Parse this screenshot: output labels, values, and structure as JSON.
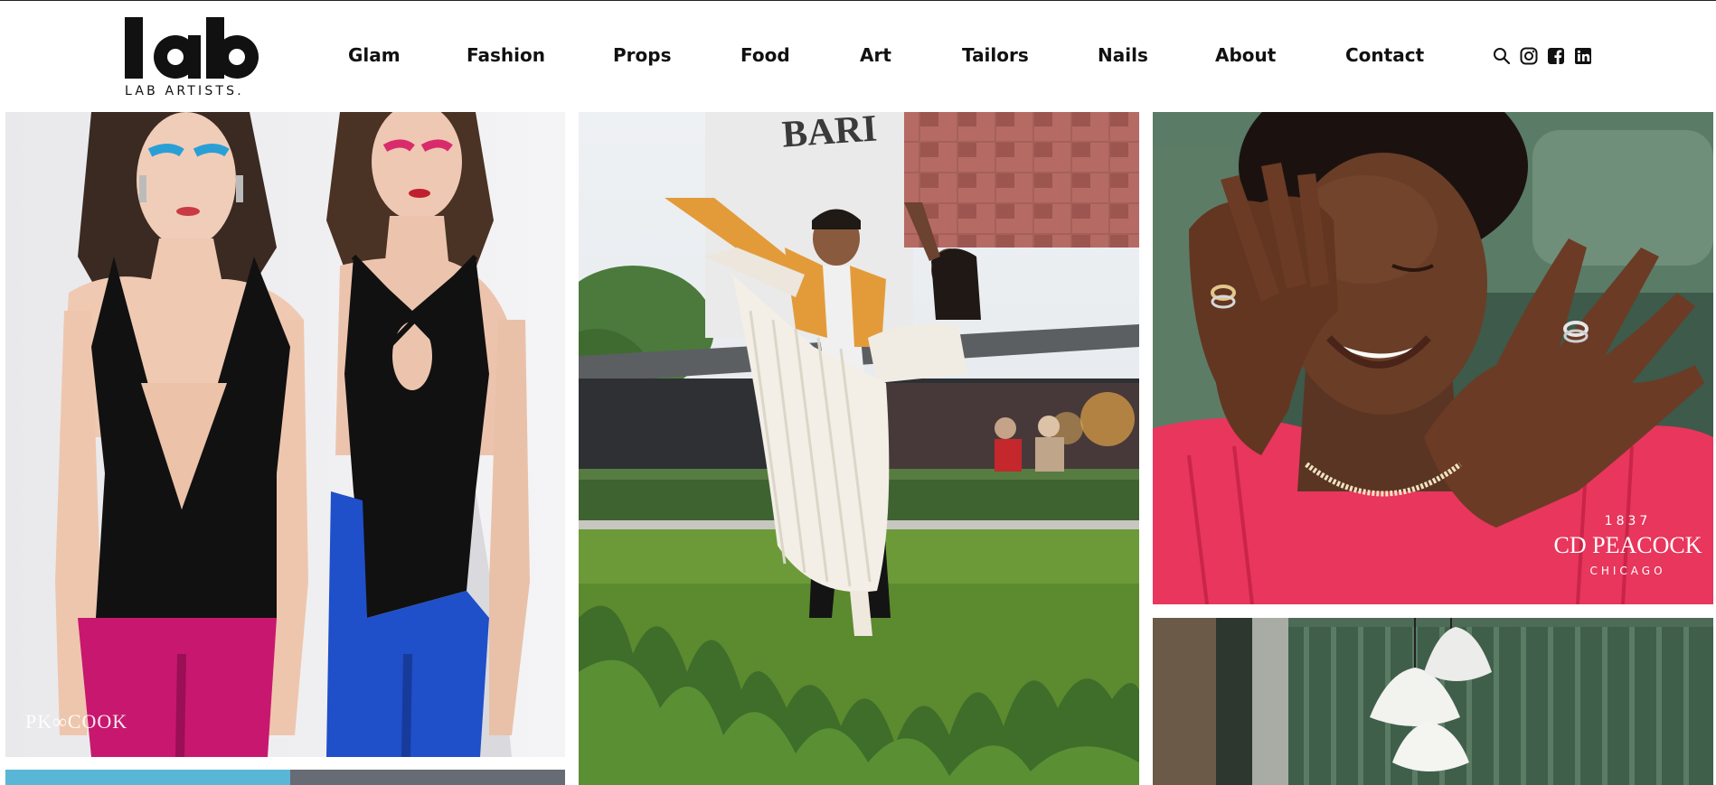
{
  "brand": {
    "logo_text": "lab",
    "logo_subtitle": "LAB ARTISTS."
  },
  "nav": {
    "items": [
      {
        "label": "Glam"
      },
      {
        "label": "Fashion"
      },
      {
        "label": "Props"
      },
      {
        "label": "Food"
      },
      {
        "label": "Art"
      },
      {
        "label": "Tailors"
      },
      {
        "label": "Nails"
      },
      {
        "label": "About"
      },
      {
        "label": "Contact"
      }
    ]
  },
  "social": {
    "icons": [
      "search-icon",
      "instagram-icon",
      "facebook-icon",
      "linkedin-icon"
    ]
  },
  "gallery": {
    "tile_fashion": {
      "watermark": "PK∞COOK"
    },
    "tile_dance": {
      "sign": "BARI"
    },
    "tile_jewelry": {
      "year": "1837",
      "name": "CD PEACOCK",
      "city": "CHICAGO"
    }
  },
  "colors": {
    "text": "#111111",
    "background": "#ffffff",
    "magenta": "#c8176f",
    "cobalt": "#1f4fc9",
    "pink_top": "#e8365c",
    "grass": "#5b8a2f"
  }
}
